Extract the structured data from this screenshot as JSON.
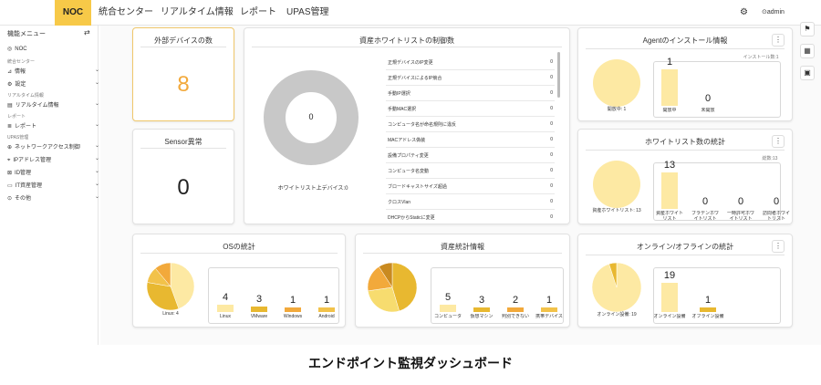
{
  "nav": {
    "tabs": [
      "NOC",
      "統合センター",
      "リアルタイム情報",
      "レポート",
      "UPAS管理"
    ],
    "user": "admin"
  },
  "sidebar": {
    "title": "機能メニュー",
    "items": [
      {
        "label": "NOC",
        "type": "item",
        "icon": "target-icon"
      },
      {
        "label": "統合センター",
        "type": "section"
      },
      {
        "label": "情報",
        "type": "item",
        "icon": "tag-icon",
        "chev": true
      },
      {
        "label": "設定",
        "type": "item",
        "icon": "gear-icon",
        "chev": true
      },
      {
        "label": "リアルタイム情報",
        "type": "section"
      },
      {
        "label": "リアルタイム情報",
        "type": "item",
        "icon": "calendar-icon",
        "chev": true
      },
      {
        "label": "レポート",
        "type": "section"
      },
      {
        "label": "レポート",
        "type": "item",
        "icon": "report-icon",
        "chev": true
      },
      {
        "label": "UPAS管理",
        "type": "section"
      },
      {
        "label": "ネットワークアクセス制御",
        "type": "item",
        "icon": "network-icon",
        "chev": true
      },
      {
        "label": "IPアドレス管理",
        "type": "item",
        "icon": "location-icon",
        "chev": true
      },
      {
        "label": "ID管理",
        "type": "item",
        "icon": "id-icon",
        "chev": true
      },
      {
        "label": "IT資産管理",
        "type": "item",
        "icon": "monitor-icon",
        "chev": true
      },
      {
        "label": "その他",
        "type": "item",
        "icon": "more-icon",
        "chev": true
      }
    ]
  },
  "cards": {
    "external": {
      "title": "外部デバイスの数",
      "value": "8"
    },
    "sensor": {
      "title": "Sensor異常",
      "value": "0"
    },
    "whitelist": {
      "title": "資産ホワイトリストの制御数",
      "center": "0",
      "footer": "ホワイトリスト上デバイス:0",
      "rows": [
        {
          "label": "正規デバイスのIP変更",
          "value": "0"
        },
        {
          "label": "正規デバイスによるIP競合",
          "value": "0"
        },
        {
          "label": "手動IP選択",
          "value": "0"
        },
        {
          "label": "手動MAC選択",
          "value": "0"
        },
        {
          "label": "コンピュータ名が命名規則に違反",
          "value": "0"
        },
        {
          "label": "MACアドレス偽装",
          "value": "0"
        },
        {
          "label": "設備プロパティ変更",
          "value": "0"
        },
        {
          "label": "コンピュータ名変動",
          "value": "0"
        },
        {
          "label": "ブロードキャストサイズ超過",
          "value": "0"
        },
        {
          "label": "クロスVlan",
          "value": "0"
        },
        {
          "label": "DHCPからStaticに変更",
          "value": "0"
        }
      ]
    },
    "agent": {
      "title": "Agentのインストール情報",
      "note": "インストール数:1",
      "pie_label": "開放中: 1",
      "bars": [
        {
          "label": "開放中",
          "value": 1
        },
        {
          "label": "未開放",
          "value": 0
        }
      ]
    },
    "wl_stats": {
      "title": "ホワイトリスト数の統計",
      "note": "総数:13",
      "pie_label": "資産ホワイトリスト: 13",
      "bars": [
        {
          "label": "資産ホワイトリスト",
          "value": 13
        },
        {
          "label": "ブラデンホワイトリスト",
          "value": 0
        },
        {
          "label": "一時許可ホワイトリスト",
          "value": 0
        },
        {
          "label": "訪問者ホワイトリスト",
          "value": 0
        }
      ]
    },
    "os": {
      "title": "OSの統計",
      "pie_label": "Linux: 4",
      "bars": [
        {
          "label": "Linux",
          "value": 4
        },
        {
          "label": "VMware",
          "value": 3
        },
        {
          "label": "Windows",
          "value": 1
        },
        {
          "label": "Android",
          "value": 1
        }
      ]
    },
    "asset": {
      "title": "資産統計情報",
      "bars": [
        {
          "label": "コンピュータ",
          "value": 5
        },
        {
          "label": "仮想マシン",
          "value": 3
        },
        {
          "label": "判別できない",
          "value": 2
        },
        {
          "label": "携帯デバイス",
          "value": 1
        }
      ]
    },
    "online": {
      "title": "オンライン/オフラインの統計",
      "pie_label": "オンライン設備: 19",
      "bars": [
        {
          "label": "オンライン設備",
          "value": 19
        },
        {
          "label": "オフライン設備",
          "value": 1
        }
      ]
    }
  },
  "caption": "エンドポイント監視ダッシュボード",
  "colors": {
    "accent": "#f7c948",
    "bar": "#fde9a3",
    "barDark": "#e8b830",
    "donut": "#c8c8c8"
  }
}
